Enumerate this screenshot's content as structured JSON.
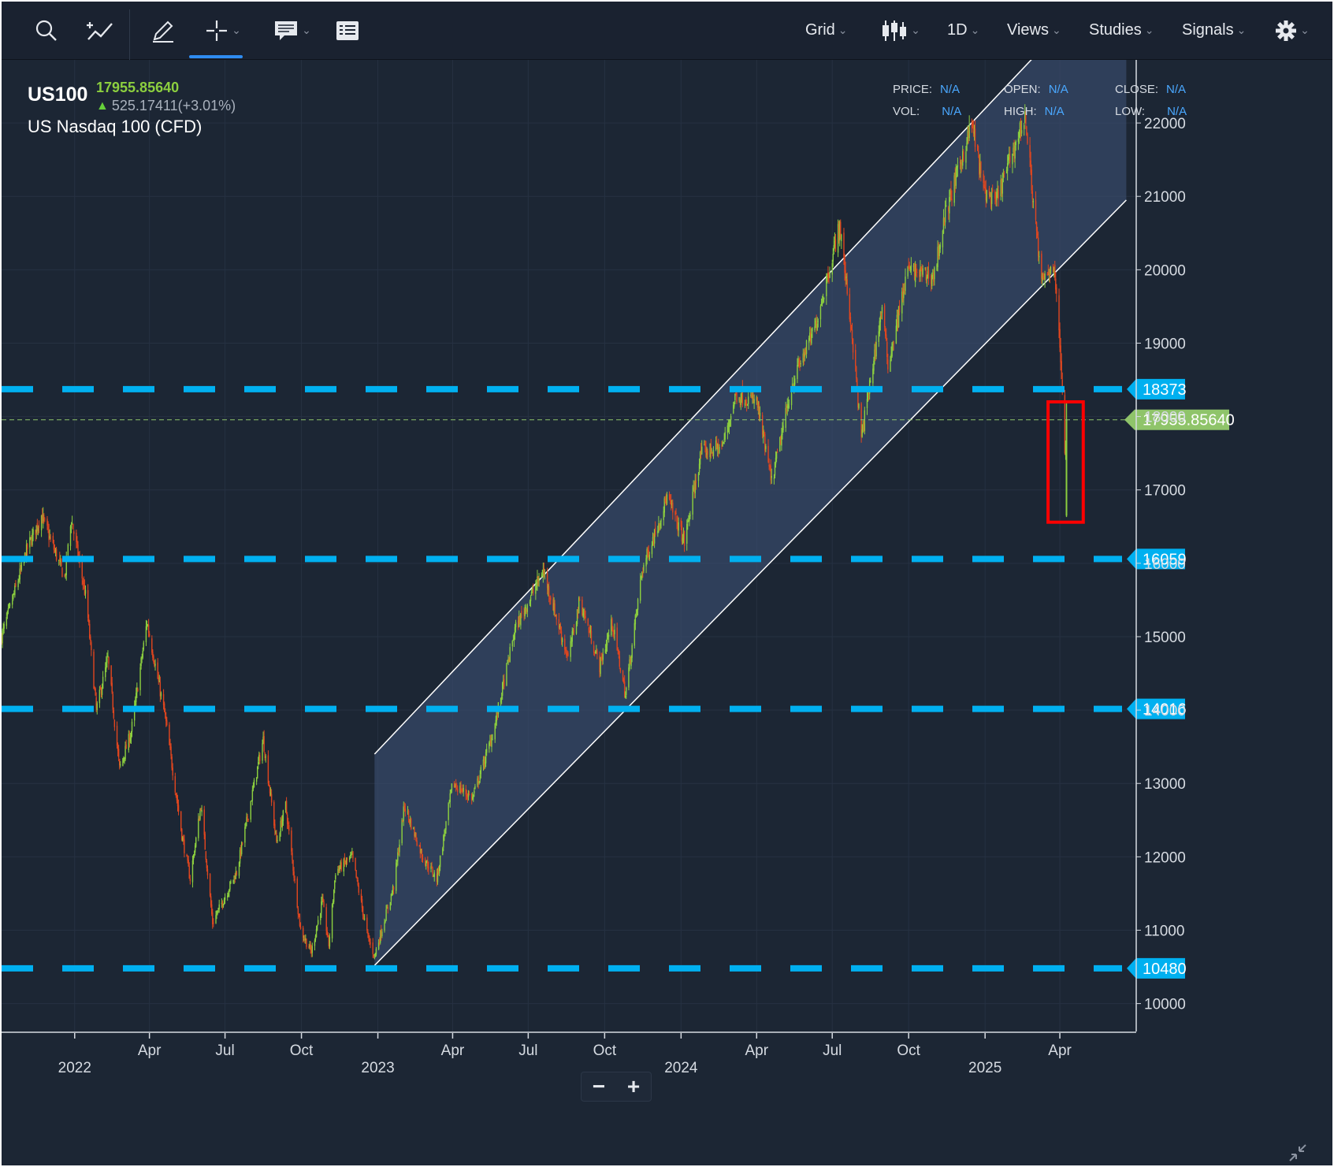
{
  "toolbar": {
    "menus": [
      "Grid",
      "1D",
      "Views",
      "Studies",
      "Signals"
    ]
  },
  "symbol": {
    "ticker": "US100",
    "last_price": "17955.85640",
    "change": "525.17411(+3.01%)",
    "name": "US Nasdaq 100 (CFD)"
  },
  "ohlc": {
    "price_label": "PRICE:",
    "price": "N/A",
    "open_label": "OPEN:",
    "open": "N/A",
    "close_label": "CLOSE:",
    "close": "N/A",
    "vol_label": "VOL:",
    "vol": "N/A",
    "high_label": "HIGH:",
    "high": "N/A",
    "low_label": "LOW:",
    "low": "N/A"
  },
  "colors": {
    "up": "#8ccf3f",
    "down": "#e0461f",
    "level_line": "#00b0f0",
    "last_price_tag": "#8fc46a",
    "highlight_box": "#ff0000",
    "channel_fill": "#3a4d6e"
  },
  "chart_data": {
    "type": "candlestick",
    "y_axis_ticks": [
      10000,
      11000,
      12000,
      13000,
      14000,
      15000,
      16000,
      17000,
      18000,
      19000,
      20000,
      21000,
      22000
    ],
    "ylim": [
      9620,
      22860
    ],
    "x_axis_ticks": [
      {
        "label": "2022",
        "date": "2022-01-01",
        "year": true
      },
      {
        "label": "Apr",
        "date": "2022-04-01"
      },
      {
        "label": "Jul",
        "date": "2022-07-01"
      },
      {
        "label": "Oct",
        "date": "2022-10-01"
      },
      {
        "label": "2023",
        "date": "2023-01-01",
        "year": true
      },
      {
        "label": "Apr",
        "date": "2023-04-01"
      },
      {
        "label": "Jul",
        "date": "2023-07-01"
      },
      {
        "label": "Oct",
        "date": "2023-10-01"
      },
      {
        "label": "2024",
        "date": "2024-01-01",
        "year": true
      },
      {
        "label": "Apr",
        "date": "2024-04-01"
      },
      {
        "label": "Jul",
        "date": "2024-07-01"
      },
      {
        "label": "Oct",
        "date": "2024-10-01"
      },
      {
        "label": "2025",
        "date": "2025-01-01",
        "year": true
      },
      {
        "label": "Apr",
        "date": "2025-04-01"
      }
    ],
    "xlim": [
      "2021-10-05",
      "2025-07-01"
    ],
    "horizontal_levels": [
      {
        "value": 18373,
        "label": "18373"
      },
      {
        "value": 16059,
        "label": "16059"
      },
      {
        "value": 14016,
        "label": "14016"
      },
      {
        "value": 10480,
        "label": "10480"
      }
    ],
    "last_price": {
      "value": 17955.8564,
      "label": "17955.85640"
    },
    "channel": {
      "lower": [
        [
          "2022-12-28",
          10520
        ],
        [
          "2025-06-20",
          20950
        ]
      ],
      "upper": [
        [
          "2022-12-28",
          13400
        ],
        [
          "2025-03-05",
          22950
        ]
      ],
      "end_date": "2025-06-20"
    },
    "highlight": {
      "start": "2025-04-02",
      "end": "2025-04-14",
      "high": 18200,
      "low": 16560
    },
    "price_path": [
      [
        "2021-10-05",
        15000
      ],
      [
        "2021-11-05",
        16200
      ],
      [
        "2021-11-22",
        16650
      ],
      [
        "2021-12-20",
        15800
      ],
      [
        "2021-12-28",
        16600
      ],
      [
        "2022-01-15",
        15500
      ],
      [
        "2022-01-27",
        14000
      ],
      [
        "2022-02-10",
        14700
      ],
      [
        "2022-02-24",
        13200
      ],
      [
        "2022-03-10",
        13700
      ],
      [
        "2022-03-29",
        15200
      ],
      [
        "2022-04-20",
        13900
      ],
      [
        "2022-05-10",
        12300
      ],
      [
        "2022-05-20",
        11700
      ],
      [
        "2022-06-02",
        12700
      ],
      [
        "2022-06-16",
        11100
      ],
      [
        "2022-07-15",
        11800
      ],
      [
        "2022-08-16",
        13600
      ],
      [
        "2022-09-01",
        12200
      ],
      [
        "2022-09-12",
        12700
      ],
      [
        "2022-09-30",
        11000
      ],
      [
        "2022-10-13",
        10700
      ],
      [
        "2022-10-26",
        11400
      ],
      [
        "2022-11-03",
        10800
      ],
      [
        "2022-11-11",
        11800
      ],
      [
        "2022-12-01",
        12000
      ],
      [
        "2022-12-20",
        10900
      ],
      [
        "2022-12-28",
        10650
      ],
      [
        "2023-01-20",
        11600
      ],
      [
        "2023-02-02",
        12700
      ],
      [
        "2023-02-24",
        12000
      ],
      [
        "2023-03-13",
        11700
      ],
      [
        "2023-04-01",
        13000
      ],
      [
        "2023-04-25",
        12800
      ],
      [
        "2023-05-20",
        13700
      ],
      [
        "2023-06-15",
        15100
      ],
      [
        "2023-07-19",
        15900
      ],
      [
        "2023-08-18",
        14700
      ],
      [
        "2023-09-01",
        15500
      ],
      [
        "2023-09-25",
        14600
      ],
      [
        "2023-10-10",
        15200
      ],
      [
        "2023-10-26",
        14200
      ],
      [
        "2023-11-15",
        15900
      ],
      [
        "2023-12-15",
        16900
      ],
      [
        "2024-01-05",
        16300
      ],
      [
        "2024-01-25",
        17500
      ],
      [
        "2024-02-20",
        17600
      ],
      [
        "2024-03-07",
        18300
      ],
      [
        "2024-04-01",
        18200
      ],
      [
        "2024-04-19",
        17100
      ],
      [
        "2024-05-15",
        18500
      ],
      [
        "2024-06-10",
        19200
      ],
      [
        "2024-07-10",
        20600
      ],
      [
        "2024-07-25",
        19100
      ],
      [
        "2024-08-05",
        17700
      ],
      [
        "2024-08-30",
        19500
      ],
      [
        "2024-09-06",
        18700
      ],
      [
        "2024-09-30",
        20000
      ],
      [
        "2024-10-31",
        19900
      ],
      [
        "2024-11-13",
        20700
      ],
      [
        "2024-12-16",
        22000
      ],
      [
        "2024-12-30",
        21100
      ],
      [
        "2025-01-13",
        20900
      ],
      [
        "2025-02-18",
        22100
      ],
      [
        "2025-03-10",
        19800
      ],
      [
        "2025-03-25",
        20100
      ],
      [
        "2025-04-03",
        18600
      ],
      [
        "2025-04-07",
        17400
      ],
      [
        "2025-04-09",
        17956
      ]
    ]
  }
}
